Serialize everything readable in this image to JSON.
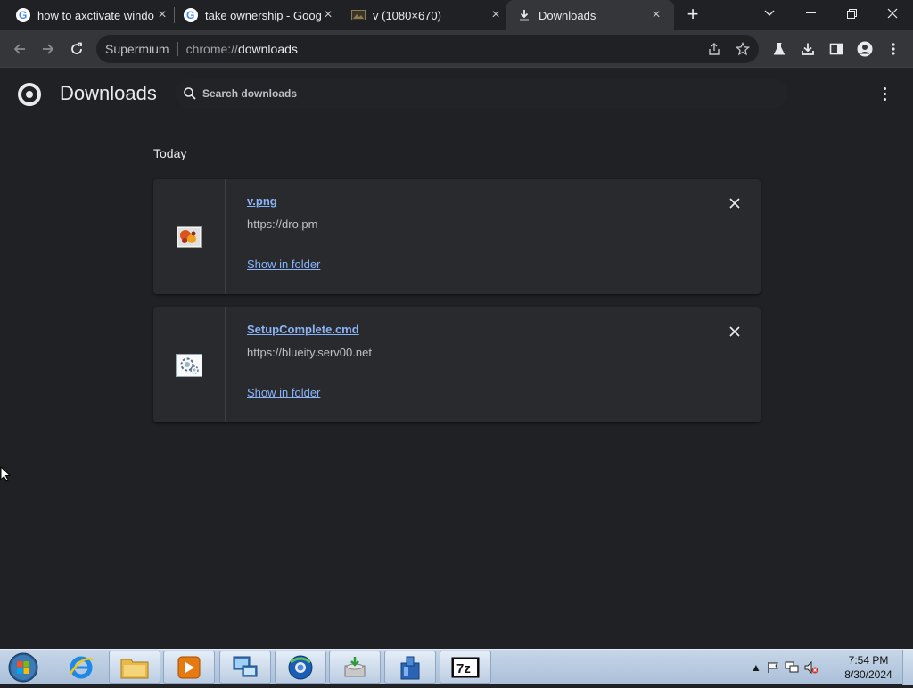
{
  "tabs": [
    {
      "title": "how to axctivate windo",
      "favicon": "google-g-icon",
      "active": false
    },
    {
      "title": "take ownership - Goog",
      "favicon": "google-g-icon",
      "active": false
    },
    {
      "title": "v (1080×670)",
      "favicon": "image-icon",
      "active": false
    },
    {
      "title": "Downloads",
      "favicon": "download-icon",
      "active": true
    }
  ],
  "toolbar": {
    "site_name": "Supermium",
    "url_scheme": "chrome://",
    "url_host": "downloads"
  },
  "page": {
    "title": "Downloads",
    "search_placeholder": "Search downloads",
    "date_heading": "Today"
  },
  "downloads": [
    {
      "filename": "v.png",
      "url": "https://dro.pm",
      "action": "Show in folder",
      "icon": "image-file-icon"
    },
    {
      "filename": "SetupComplete.cmd",
      "url": "https://blueity.serv00.net",
      "action": "Show in folder",
      "icon": "cmd-file-icon"
    }
  ],
  "taskbar": {
    "time": "7:54 PM",
    "date": "8/30/2024"
  },
  "colors": {
    "page_bg": "#202124",
    "card_bg": "#292a2d",
    "link": "#8ab4f8",
    "toolbar_bg": "#35363a"
  }
}
